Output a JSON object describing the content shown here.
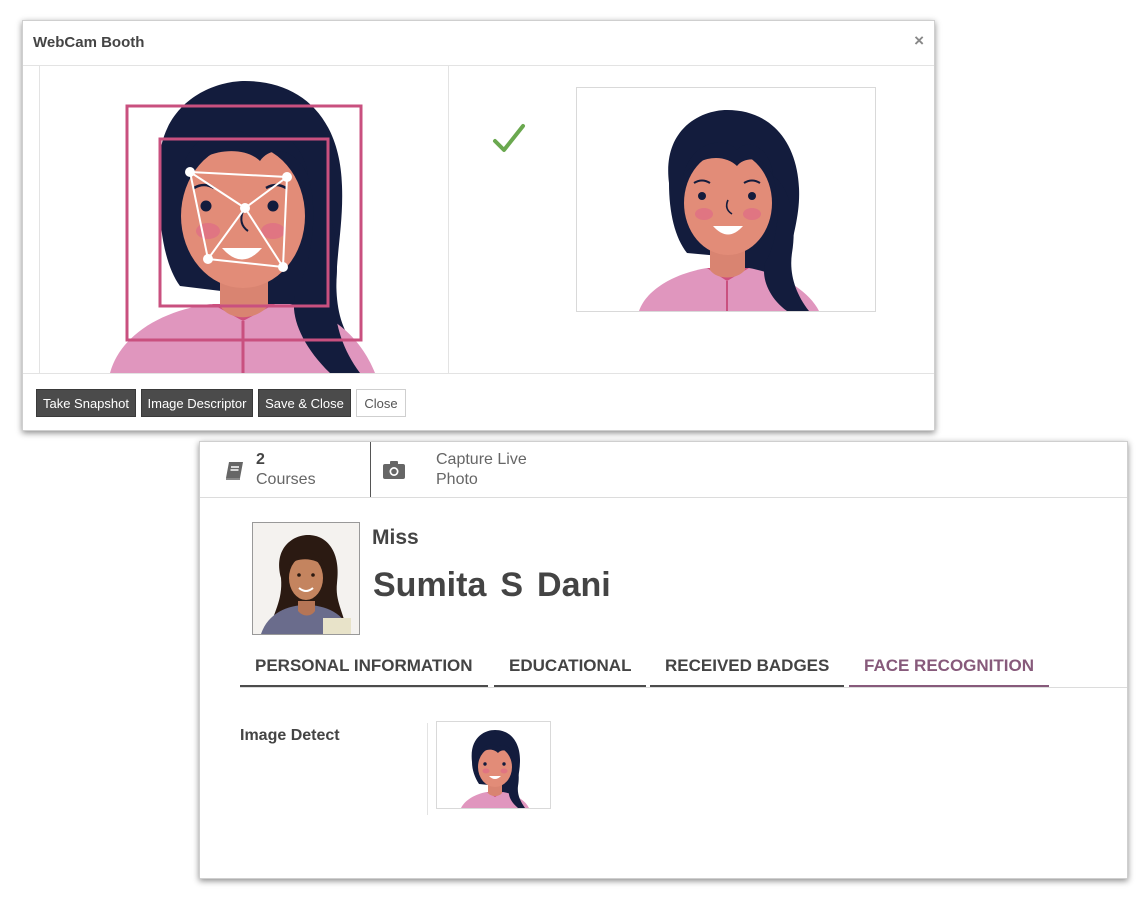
{
  "dialog": {
    "title": "WebCam Booth",
    "close_glyph": "×",
    "buttons": {
      "take_snapshot": "Take Snapshot",
      "image_descriptor": "Image Descriptor",
      "save_close": "Save & Close",
      "close": "Close"
    },
    "status_icon": "checkmark-icon",
    "status_color": "#6aa84f",
    "detection_color": "#c9507f"
  },
  "form": {
    "smart_buttons": [
      {
        "count": "2",
        "label": "Courses",
        "icon": "book-icon"
      },
      {
        "label_line1": "Capture Live",
        "label_line2": "Photo",
        "icon": "camera-icon"
      }
    ],
    "student": {
      "title": "Miss",
      "first_name": "Sumita",
      "middle_name": "S",
      "last_name": "Dani"
    },
    "tabs": [
      "PERSONAL INFORMATION",
      "EDUCATIONAL",
      "RECEIVED BADGES",
      "FACE RECOGNITION"
    ],
    "active_tab": "FACE RECOGNITION",
    "accent_color": "#875a7b",
    "fields": {
      "image_detect_label": "Image Detect"
    }
  }
}
